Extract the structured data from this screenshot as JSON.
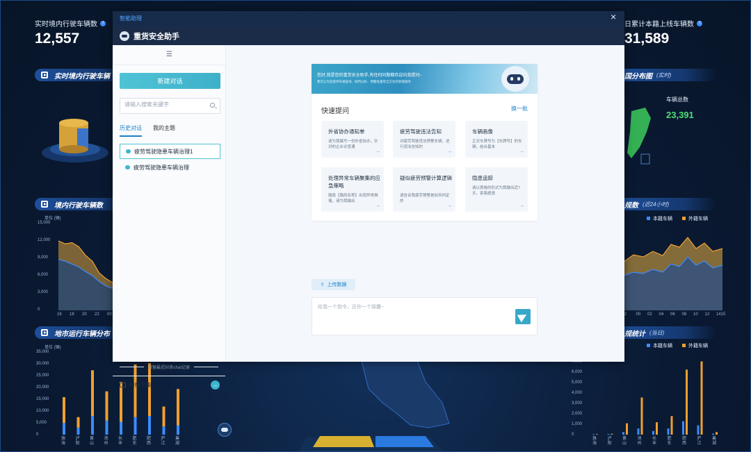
{
  "dashboard": {
    "stat_left": {
      "label": "实时境内行驶车辆数",
      "value": "12,557"
    },
    "stat_right": {
      "label": "日累计本籍上线车辆数",
      "value": "31,589"
    },
    "sec_realtime": "实时境内行驶车辆",
    "sec_domestic": "境内行驶车辆数",
    "sec_city": "地市运行车辆分布",
    "sec_map": "国分布图",
    "sec_map_sub": "(实时)",
    "sec_scale": "规数",
    "sec_scale_sub": "(近24小时)",
    "sec_stats": "规统计",
    "sec_stats_sub": "(当日)",
    "total_label": "车辆总数",
    "total_value": "23,391",
    "unit_left_top": "单位 (辆)",
    "unit_left_bottom": "单位 (辆)",
    "legend_local": "本籍车辆",
    "legend_foreign": "外籍车辆",
    "left_line_y_ticks": [
      "15,000",
      "12,000",
      "9,000",
      "6,000",
      "3,000",
      "0"
    ],
    "left_line_x_ticks": [
      "16",
      "18",
      "20",
      "22",
      "00"
    ],
    "right_line_x_ticks": [
      "2",
      "00",
      "02",
      "04",
      "06",
      "08",
      "10",
      "12",
      "1415"
    ],
    "left_bar_y_ticks": [
      "35,000",
      "30,000",
      "25,000",
      "20,000",
      "15,000",
      "10,000",
      "5,000",
      "0"
    ],
    "right_bar_y_ticks": [
      "7,000",
      "6,000",
      "5,000",
      "4,000",
      "3,000",
      "2,000",
      "1,000",
      "0"
    ],
    "bar_categories": [
      "珠海",
      "泸阳",
      "黄山",
      "池州",
      "长丰",
      "肥东",
      "肥西",
      "庐江",
      "巢湖"
    ]
  },
  "modal": {
    "tag": "智能助理",
    "close": "×",
    "title": "重货安全助手",
    "menu_icon": "☰",
    "new_chat": "新建对话",
    "search_placeholder": "请输入搜索关键字",
    "tab_history": "历史对话",
    "tab_topics": "我的主题",
    "history": [
      "疲劳驾驶隐患车辆治理1",
      "疲劳驾驶隐患车辆治理"
    ],
    "keep_note": "保留最近50条chat记录",
    "ai_cmd": "AI指令集",
    "ai_go": "→",
    "banner_line1": "您好,我是您的重货安全助手,有任何问题都欢迎向我提问~",
    "banner_line2": "我可以为您提供车辆查询、研判分析、预警处置等全方位的智能服务",
    "quick_title": "快速提问",
    "quick_switch": "换一批",
    "cards": [
      {
        "title": "外省协办通知单",
        "desc": "请为我撰写一份外省协办，针对的企业诊查通"
      },
      {
        "title": "疲劳驾驶违法告知",
        "desc": "对疲劳驾驶违法预警车辆，进行违法告知的"
      },
      {
        "title": "车辆画像",
        "desc": "正对车牌号为【车牌号】的车辆，结合基本"
      },
      {
        "title": "处理异常车辆聚集的应急策略",
        "desc": "路段【路段名称】出现异常揭堵，请为我输出"
      },
      {
        "title": "疑似疲劳预警计算逻辑",
        "desc": "请告诉我疲劳预警是如何判定的"
      },
      {
        "title": "隐患追踪",
        "desc": "请以表格的形式为我输出近7天，容易超速"
      }
    ],
    "upload": "上传数据",
    "input_placeholder": "给我一个指令，还你一个锦囊~"
  },
  "chart_data": [
    {
      "type": "area",
      "title": "境内行驶车辆数",
      "ylabel": "单位 (辆)",
      "ylim": [
        0,
        15000
      ],
      "x": [
        "16",
        "17",
        "18",
        "19",
        "20",
        "21",
        "22",
        "23",
        "00"
      ],
      "series": [
        {
          "name": "外籍车辆",
          "values": [
            12000,
            11500,
            11700,
            11000,
            9500,
            8500,
            6500,
            5500,
            4800
          ]
        },
        {
          "name": "本籍车辆",
          "values": [
            8800,
            8500,
            8000,
            7500,
            6700,
            6000,
            5000,
            4200,
            3800
          ]
        }
      ]
    },
    {
      "type": "bar",
      "title": "地市运行车辆分布",
      "ylabel": "单位 (辆)",
      "ylim": [
        0,
        35000
      ],
      "categories": [
        "珠海",
        "泸阳",
        "黄山",
        "池州",
        "长丰",
        "肥东",
        "肥西",
        "庐江",
        "巢湖"
      ],
      "series": [
        {
          "name": "本籍车辆",
          "values": [
            5000,
            3000,
            8000,
            6000,
            5500,
            7500,
            8000,
            3500,
            4000
          ]
        },
        {
          "name": "外籍车辆",
          "values": [
            11000,
            4500,
            19500,
            12500,
            17000,
            22500,
            22500,
            8500,
            15500
          ]
        }
      ]
    },
    {
      "type": "bar",
      "title": "规统计",
      "ylim": [
        0,
        7000
      ],
      "categories": [
        "珠海",
        "泸阳",
        "黄山",
        "池州",
        "长丰",
        "肥东",
        "肥西",
        "庐江",
        "巢湖"
      ],
      "series": [
        {
          "name": "本籍车辆",
          "values": [
            50,
            60,
            250,
            600,
            350,
            600,
            1300,
            900,
            100
          ]
        },
        {
          "name": "外籍车辆",
          "values": [
            50,
            80,
            1100,
            3600,
            1200,
            1800,
            6300,
            7100,
            250
          ]
        }
      ]
    }
  ],
  "colors": {
    "local": "#3b8cff",
    "foreign": "#f0a030",
    "accent": "#3db5cf"
  }
}
